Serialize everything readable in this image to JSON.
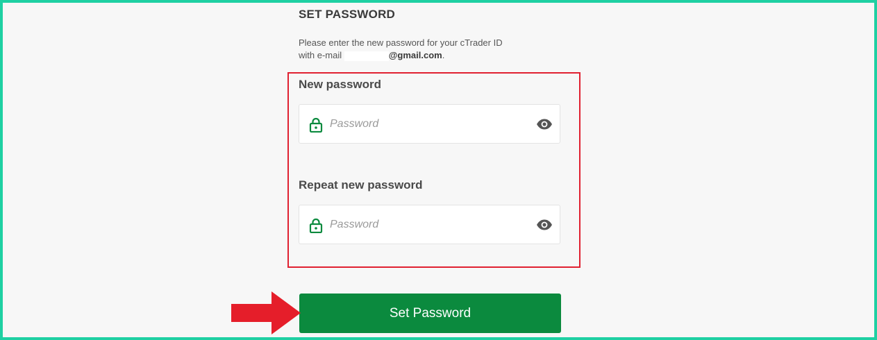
{
  "page": {
    "title": "SET PASSWORD",
    "description_line1": "Please enter the new password for your cTrader ID",
    "description_prefix": "with e-mail",
    "email_domain": "@gmail.com",
    "email_suffix": "."
  },
  "form": {
    "new_password": {
      "label": "New password",
      "placeholder": "Password",
      "icon": "lock-icon",
      "toggle_icon": "eye-icon"
    },
    "repeat_password": {
      "label": "Repeat new password",
      "placeholder": "Password",
      "icon": "lock-icon",
      "toggle_icon": "eye-icon"
    },
    "submit_label": "Set Password"
  },
  "colors": {
    "frame_border": "#1fd0a3",
    "highlight_border": "#e02030",
    "button_bg": "#0b8a3e",
    "icon_green": "#0b8a3e",
    "arrow_red": "#e51e2a"
  }
}
